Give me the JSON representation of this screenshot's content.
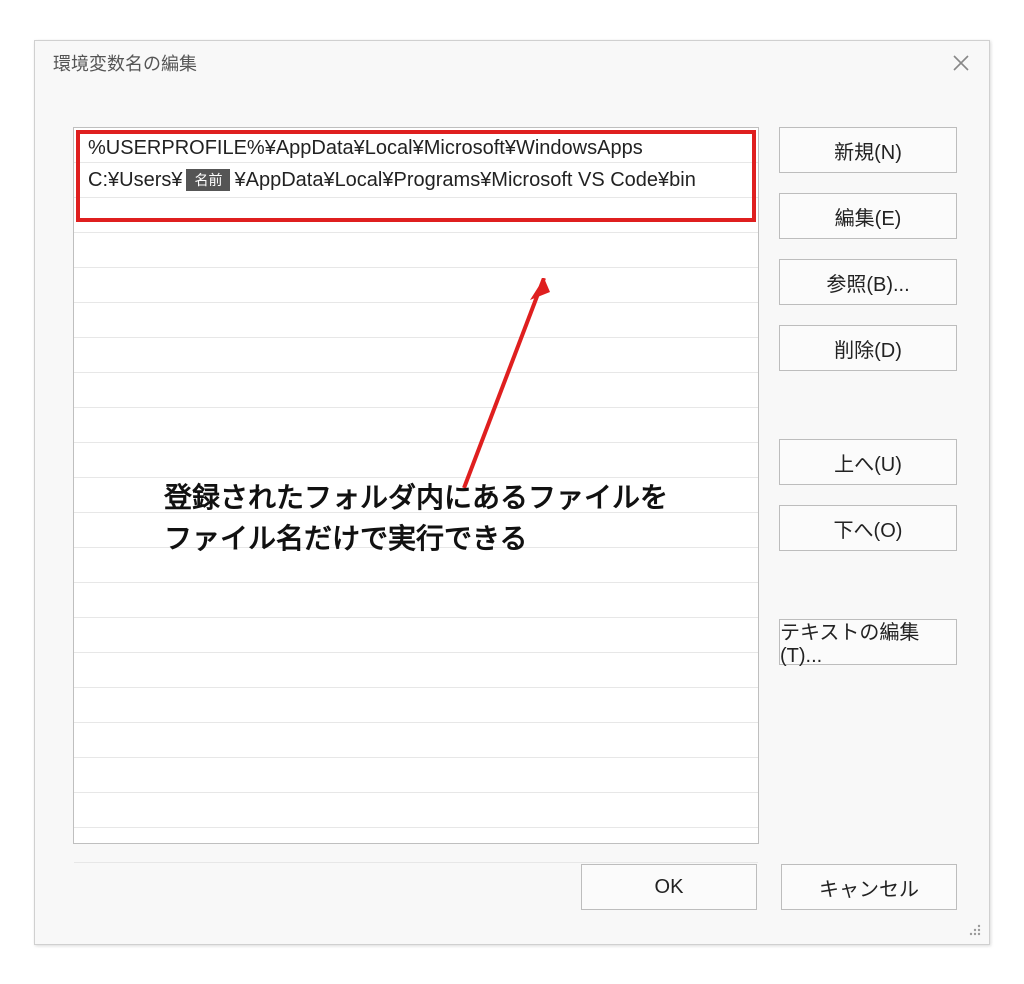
{
  "dialog": {
    "title": "環境変数名の編集",
    "paths": [
      {
        "pre": "%USERPROFILE%¥AppData¥Local¥Microsoft¥WindowsApps",
        "chip": null,
        "post": ""
      },
      {
        "pre": "C:¥Users¥",
        "chip": "名前",
        "post": "¥AppData¥Local¥Programs¥Microsoft VS Code¥bin"
      }
    ],
    "blank_row_count": 19
  },
  "side_buttons": {
    "new": "新規(N)",
    "edit": "編集(E)",
    "browse": "参照(B)...",
    "delete": "削除(D)",
    "up": "上へ(U)",
    "down": "下へ(O)",
    "text_edit": "テキストの編集(T)..."
  },
  "footer": {
    "ok": "OK",
    "cancel": "キャンセル"
  },
  "annotation": {
    "line1": "登録されたフォルダ内にあるファイルを",
    "line2": "ファイル名だけで実行できる"
  }
}
